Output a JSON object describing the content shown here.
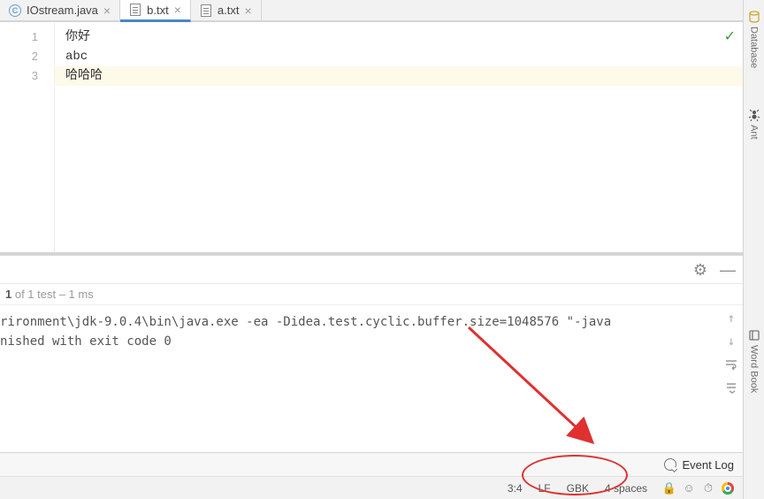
{
  "tabs": [
    {
      "label": "IOstream.java",
      "type": "java",
      "active": false
    },
    {
      "label": "b.txt",
      "type": "txt",
      "active": true
    },
    {
      "label": "a.txt",
      "type": "txt",
      "active": false
    }
  ],
  "editor": {
    "lines": [
      {
        "num": "1",
        "text": "你好",
        "highlighted": false
      },
      {
        "num": "2",
        "text": "abc",
        "highlighted": false
      },
      {
        "num": "3",
        "text": "哈哈哈",
        "highlighted": true
      }
    ],
    "status_ok": "✓"
  },
  "test_summary": {
    "bold": "1",
    "rest": " of 1 test – 1 ms"
  },
  "console": {
    "line1": "rironment\\jdk-9.0.4\\bin\\java.exe -ea -Didea.test.cyclic.buffer.size=1048576 \"-java",
    "line2": "",
    "line3": "nished with exit code 0"
  },
  "event_log_label": "Event Log",
  "status_bar": {
    "caret": "3:4",
    "line_sep": "LF",
    "encoding": "GBK",
    "indent": "4 spaces"
  },
  "right_rail": {
    "database": "Database",
    "ant": "Ant",
    "wordbook": "Word Book"
  }
}
